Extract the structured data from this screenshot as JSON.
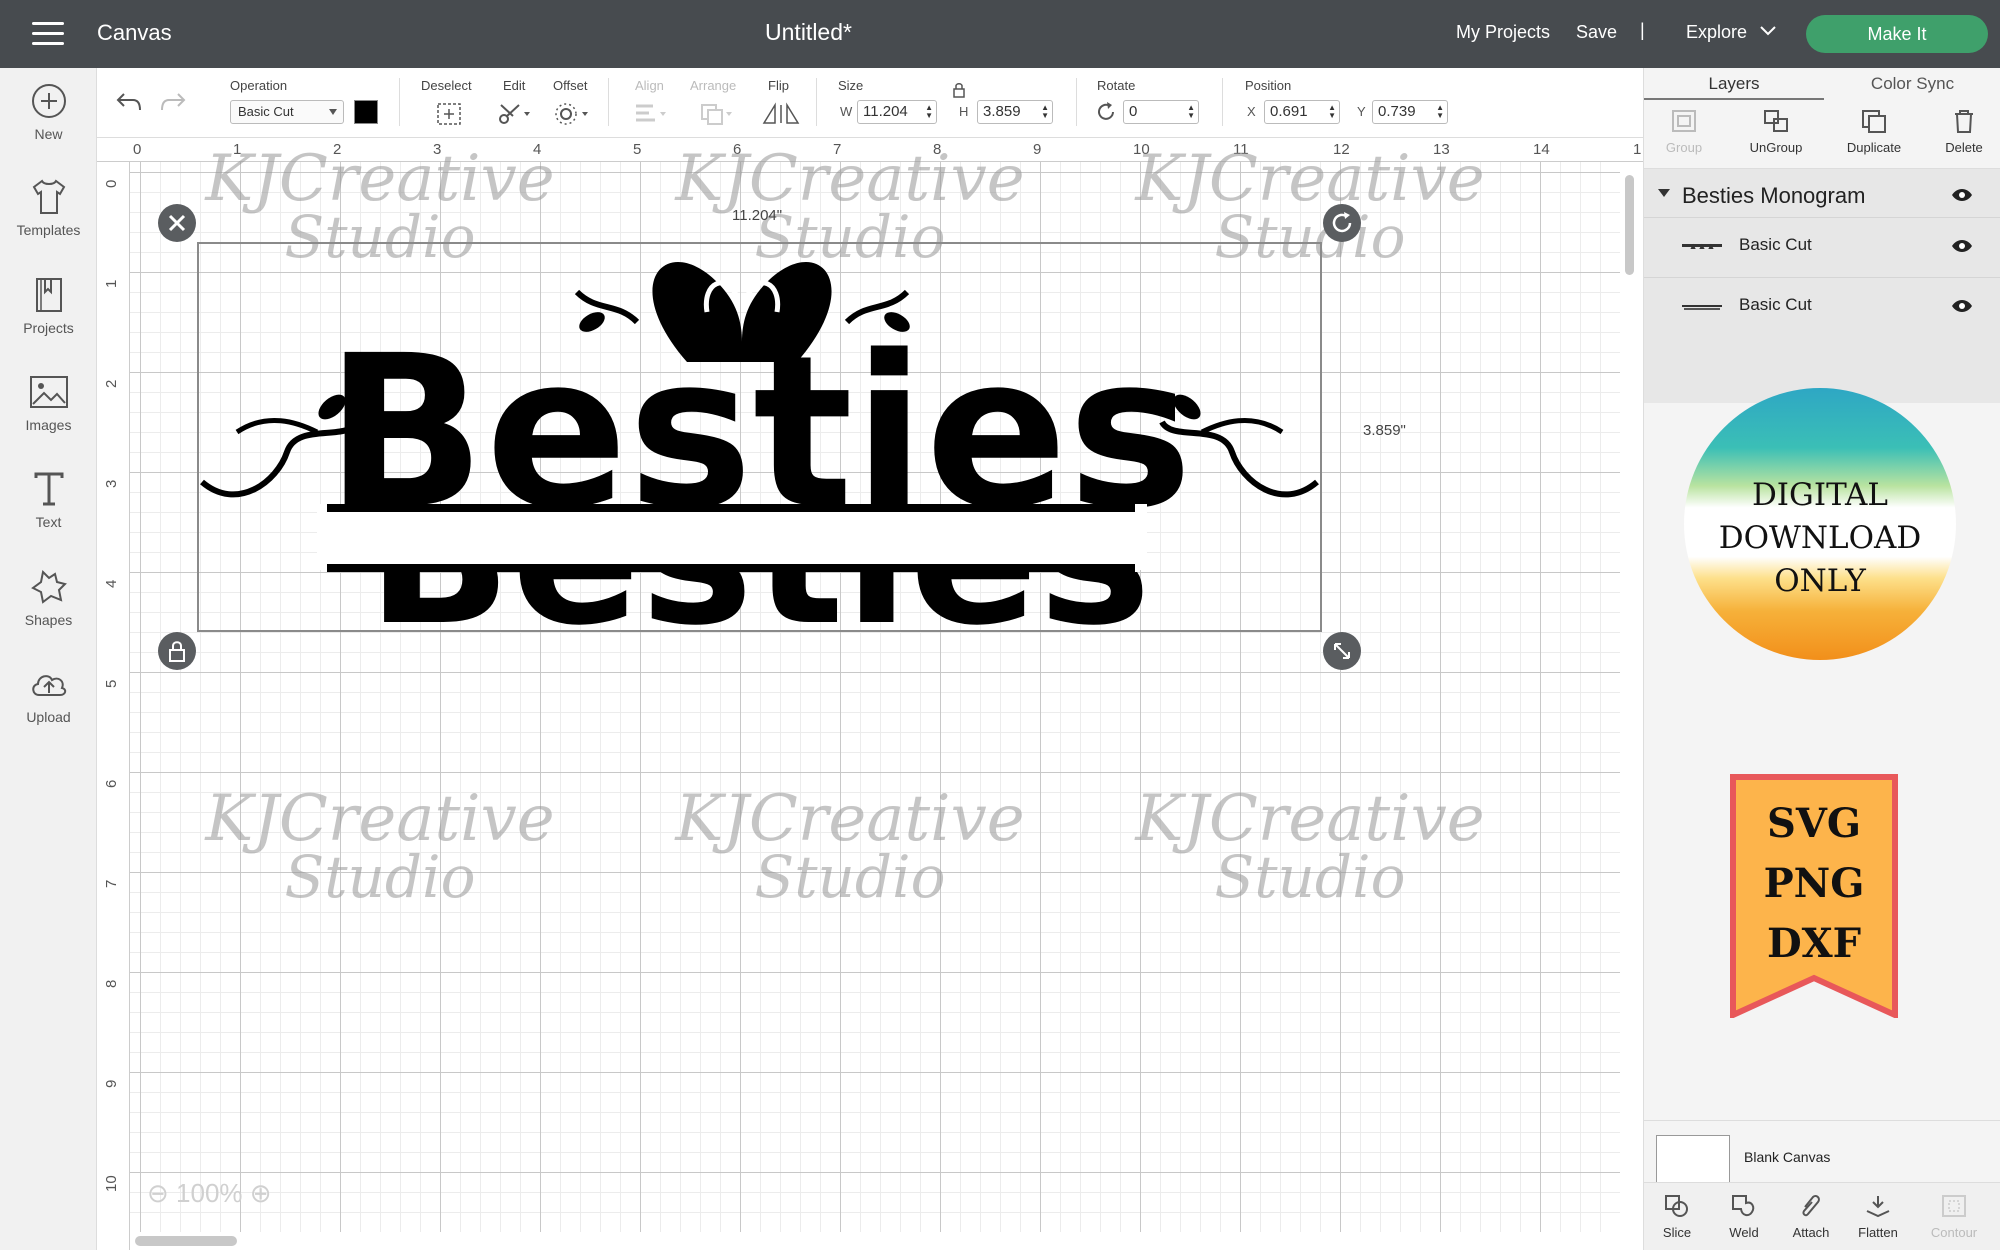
{
  "header": {
    "app_name": "Canvas",
    "doc_title": "Untitled*",
    "my_projects": "My Projects",
    "save": "Save",
    "separator": "|",
    "explore": "Explore",
    "make_it": "Make It"
  },
  "sidebar": {
    "items": [
      {
        "label": "New",
        "icon": "plus-circle-icon"
      },
      {
        "label": "Templates",
        "icon": "shirt-icon"
      },
      {
        "label": "Projects",
        "icon": "bookmark-book-icon"
      },
      {
        "label": "Images",
        "icon": "image-icon"
      },
      {
        "label": "Text",
        "icon": "text-t-icon"
      },
      {
        "label": "Shapes",
        "icon": "shapes-icon"
      },
      {
        "label": "Upload",
        "icon": "cloud-upload-icon"
      }
    ]
  },
  "toolbar": {
    "operation_label": "Operation",
    "operation_value": "Basic Cut",
    "operation_color": "#000000",
    "deselect_label": "Deselect",
    "edit_label": "Edit",
    "offset_label": "Offset",
    "align_label": "Align",
    "arrange_label": "Arrange",
    "flip_label": "Flip",
    "size_label": "Size",
    "width_prefix": "W",
    "width_value": "11.204",
    "height_prefix": "H",
    "height_value": "3.859",
    "rotate_label": "Rotate",
    "rotate_value": "0",
    "position_label": "Position",
    "x_prefix": "X",
    "x_value": "0.691",
    "y_prefix": "Y",
    "y_value": "0.739"
  },
  "canvas": {
    "ruler_top": [
      "0",
      "1",
      "2",
      "3",
      "4",
      "5",
      "6",
      "7",
      "8",
      "9",
      "10",
      "11",
      "12",
      "13",
      "14",
      "1"
    ],
    "ruler_left": [
      "0",
      "1",
      "2",
      "3",
      "4",
      "5",
      "6",
      "7",
      "8",
      "9",
      "10"
    ],
    "width_dim": "11.204\"",
    "height_dim": "3.859\"",
    "zoom": "100%",
    "watermark_line1": "KJCreative",
    "watermark_line2": "Studio",
    "design_text_top": "Besties",
    "design_text_bottom": "Besties"
  },
  "panel": {
    "tabs": [
      "Layers",
      "Color Sync"
    ],
    "tools": [
      {
        "label": "Group",
        "enabled": false,
        "icon": "group-icon"
      },
      {
        "label": "UnGroup",
        "enabled": true,
        "icon": "ungroup-icon"
      },
      {
        "label": "Duplicate",
        "enabled": true,
        "icon": "duplicate-icon"
      },
      {
        "label": "Delete",
        "enabled": true,
        "icon": "trash-icon"
      }
    ],
    "group_name": "Besties Monogram",
    "layers": [
      {
        "name": "Basic Cut"
      },
      {
        "name": "Basic Cut"
      }
    ],
    "promo_circle": [
      "DIGITAL",
      "DOWNLOAD",
      "ONLY"
    ],
    "promo_banner": [
      "SVG",
      "PNG",
      "DXF"
    ],
    "blank_canvas": "Blank Canvas",
    "bottom_tools": [
      {
        "label": "Slice",
        "enabled": true,
        "icon": "slice-icon"
      },
      {
        "label": "Weld",
        "enabled": true,
        "icon": "weld-icon"
      },
      {
        "label": "Attach",
        "enabled": true,
        "icon": "paperclip-icon"
      },
      {
        "label": "Flatten",
        "enabled": true,
        "icon": "flatten-icon"
      },
      {
        "label": "Contour",
        "enabled": false,
        "icon": "contour-icon"
      }
    ]
  },
  "colors": {
    "header_bg": "#474b4f",
    "make_it_green": "#3fa06b",
    "banner_fill": "#fdb44b",
    "banner_border": "#e8585a"
  }
}
